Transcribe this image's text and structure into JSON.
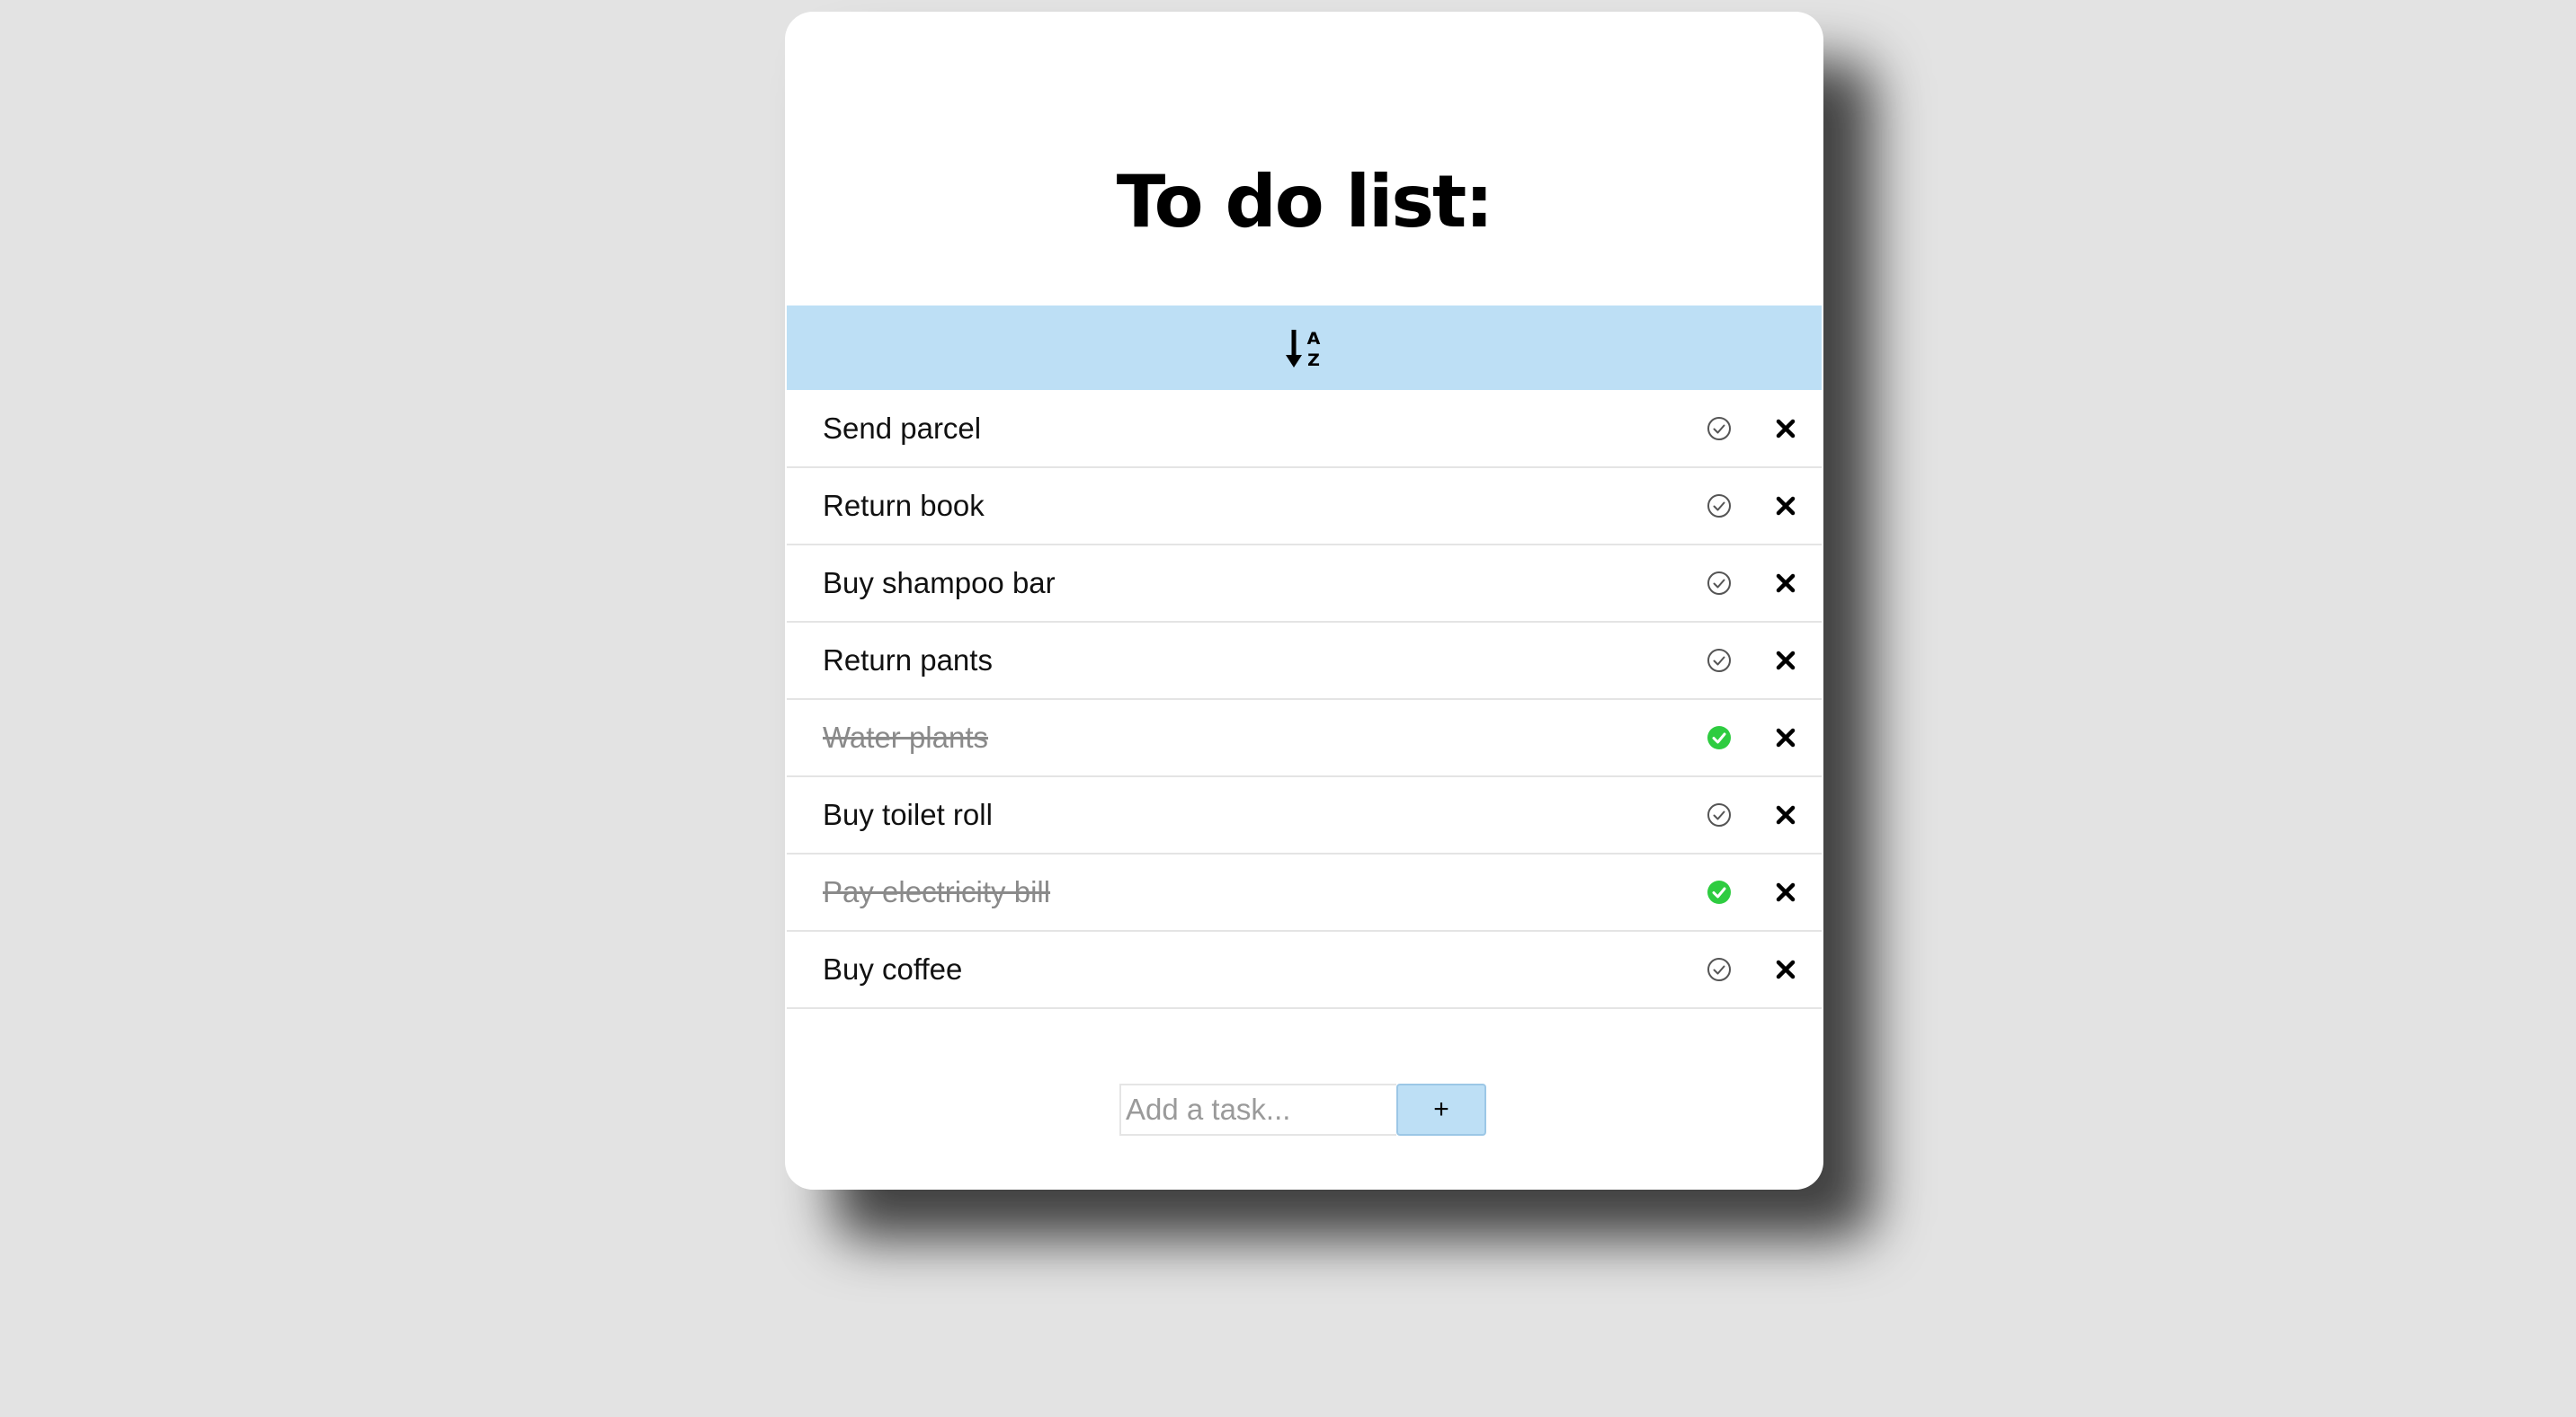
{
  "app": {
    "title": "To do list:",
    "accent_color": "#bddff5",
    "done_color": "#2ecc40"
  },
  "sort": {
    "icon": "sort-alpha-down-icon"
  },
  "tasks": [
    {
      "label": "Send parcel",
      "done": false
    },
    {
      "label": "Return book",
      "done": false
    },
    {
      "label": "Buy shampoo bar",
      "done": false
    },
    {
      "label": "Return pants",
      "done": false
    },
    {
      "label": "Water plants",
      "done": true
    },
    {
      "label": "Buy toilet roll",
      "done": false
    },
    {
      "label": "Pay electricity bill",
      "done": true
    },
    {
      "label": "Buy coffee",
      "done": false
    }
  ],
  "add": {
    "placeholder": "Add a task...",
    "value": "",
    "button_label": "+"
  }
}
